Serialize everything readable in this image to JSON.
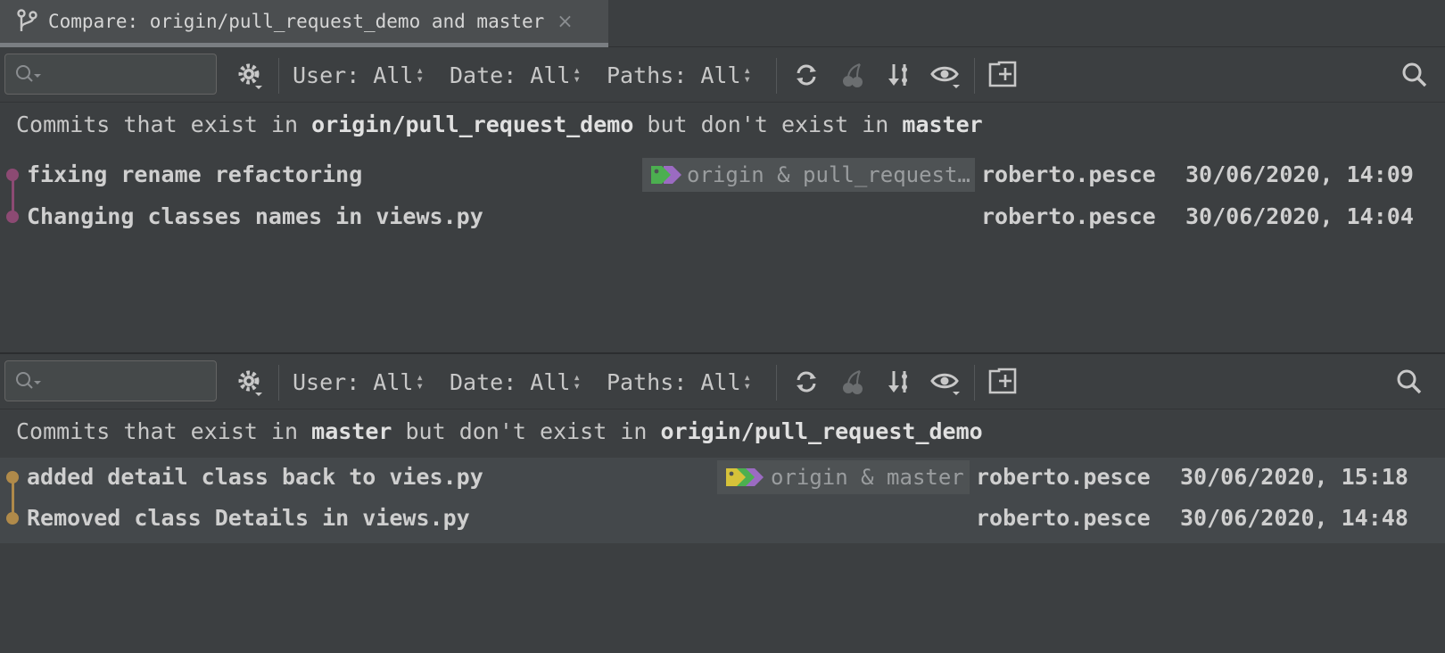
{
  "tab": {
    "title": "Compare: origin/pull_request_demo and master",
    "close": "×"
  },
  "filters": {
    "user": "User: All",
    "date": "Date: All",
    "paths": "Paths: All"
  },
  "top_panel": {
    "header_prefix": "Commits that exist in ",
    "header_branch_a": "origin/pull_request_demo",
    "header_middle": " but don't exist in ",
    "header_branch_b": "master",
    "graph_color": "#8c4a73",
    "commits": [
      {
        "subject": "fixing rename refactoring",
        "tag": "origin & pull_request…",
        "author": "roberto.pesce",
        "date": "30/06/2020, 14:09"
      },
      {
        "subject": "Changing classes names in views.py",
        "tag": "",
        "author": "roberto.pesce",
        "date": "30/06/2020, 14:04"
      }
    ]
  },
  "bottom_panel": {
    "header_prefix": "Commits that exist in ",
    "header_branch_a": "master",
    "header_middle": " but don't exist in ",
    "header_branch_b": "origin/pull_request_demo",
    "graph_color": "#b08a4a",
    "commits": [
      {
        "subject": "added detail class back to vies.py",
        "tag": "origin & master",
        "author": "roberto.pesce",
        "date": "30/06/2020, 15:18"
      },
      {
        "subject": "Removed class Details in views.py",
        "tag": "",
        "author": "roberto.pesce",
        "date": "30/06/2020, 14:48"
      }
    ]
  },
  "icons": [
    "branch-icon",
    "search-icon",
    "gear-icon",
    "refresh-icon",
    "cherry-pick-icon",
    "sort-icon",
    "eye-icon",
    "add-tab-icon",
    "find-icon",
    "tag-icon"
  ],
  "colors": {
    "accent_green_tag": "#4caf50",
    "accent_purple_tag": "#9b6bc2",
    "accent_yellow_tag": "#d6c23a"
  }
}
